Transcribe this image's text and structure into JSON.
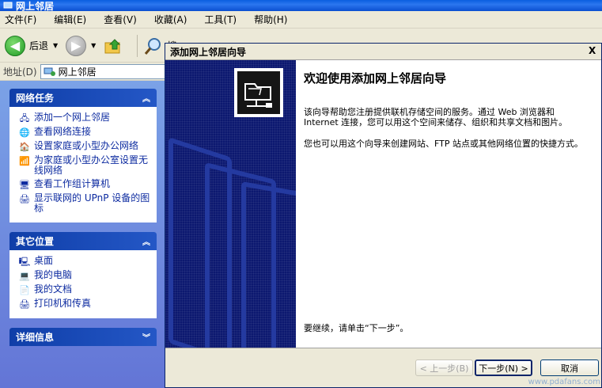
{
  "explorer": {
    "title": "网上邻居",
    "menu": [
      "文件(F)",
      "编辑(E)",
      "查看(V)",
      "收藏(A)",
      "工具(T)",
      "帮助(H)"
    ],
    "toolbar": {
      "back_label": "后退",
      "search_label": "搜"
    },
    "address": {
      "label": "地址(D)",
      "value": "网上邻居"
    }
  },
  "sidebar": {
    "network_tasks": {
      "title": "网络任务",
      "items": [
        {
          "label": "添加一个网上邻居",
          "icon": "add-network-place-icon"
        },
        {
          "label": "查看网络连接",
          "icon": "network-connections-icon"
        },
        {
          "label": "设置家庭或小型办公网络",
          "icon": "home-network-icon"
        },
        {
          "label": "为家庭或小型办公室设置无线网络",
          "icon": "wireless-network-icon"
        },
        {
          "label": "查看工作组计算机",
          "icon": "workgroup-computers-icon"
        },
        {
          "label": "显示联网的 UPnP 设备的图标",
          "icon": "upnp-device-icon"
        }
      ]
    },
    "other_places": {
      "title": "其它位置",
      "items": [
        {
          "label": "桌面",
          "icon": "desktop-icon"
        },
        {
          "label": "我的电脑",
          "icon": "my-computer-icon"
        },
        {
          "label": "我的文档",
          "icon": "my-documents-icon"
        },
        {
          "label": "打印机和传真",
          "icon": "printers-faxes-icon"
        }
      ]
    },
    "details": {
      "title": "详细信息"
    }
  },
  "wizard": {
    "title": "添加网上邻居向导",
    "heading": "欢迎使用添加网上邻居向导",
    "para1": "该向导帮助您注册提供联机存储空间的服务。通过 Web 浏览器和 Internet 连接，您可以用这个空间来储存、组织和共享文档和图片。",
    "para2": "您也可以用这个向导来创建网站、FTP 站点或其他网络位置的快捷方式。",
    "continue_text": "要继续，请单击“下一步”。",
    "buttons": {
      "back": "< 上一步(B)",
      "next": "下一步(N) >",
      "cancel": "取消"
    },
    "close": "X"
  },
  "watermark": "www.pdafans.com",
  "colors": {
    "title_blue": "#0a5ee0",
    "sidebar_blue": "#6375d6",
    "banner_navy": "#0c1870",
    "link_blue": "#0d2ba0"
  }
}
